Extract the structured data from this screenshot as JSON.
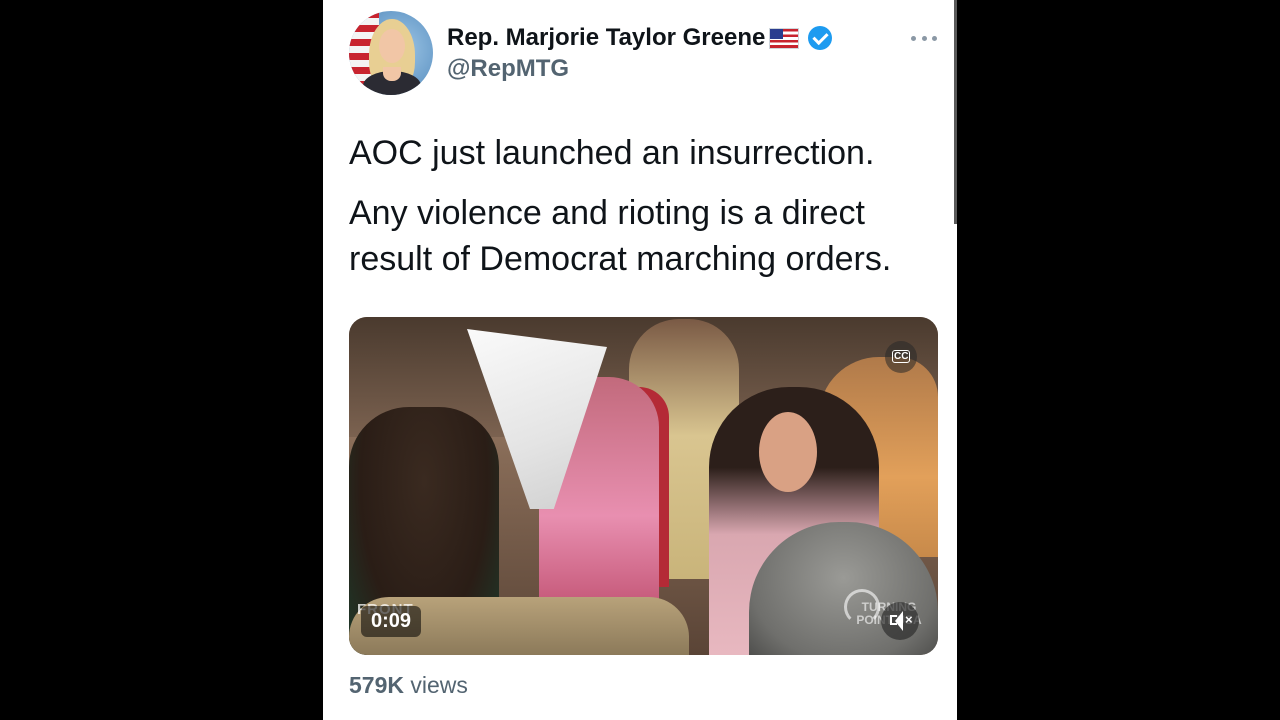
{
  "tweet": {
    "display_name": "Rep. Marjorie Taylor Greene",
    "flag_icon": "us-flag-icon",
    "verified_icon": "verified-badge-icon",
    "handle": "@RepMTG",
    "text_paragraphs": [
      "AOC just launched an insurrection.",
      "Any violence and rioting is a direct result of Democrat marching orders."
    ],
    "media": {
      "type": "video",
      "duration": "0:09",
      "cc_icon": "closed-captions-icon",
      "mute_icon": "volume-muted-icon",
      "watermark_left": "FRONT",
      "watermark_right": "TURNING POINT USA"
    },
    "views_count": "579K",
    "views_label": "views"
  },
  "colors": {
    "primary_text": "#0f1419",
    "secondary_text": "#536471",
    "verified_blue": "#1d9bf0",
    "background_outer": "#000000",
    "card_background": "#ffffff"
  }
}
